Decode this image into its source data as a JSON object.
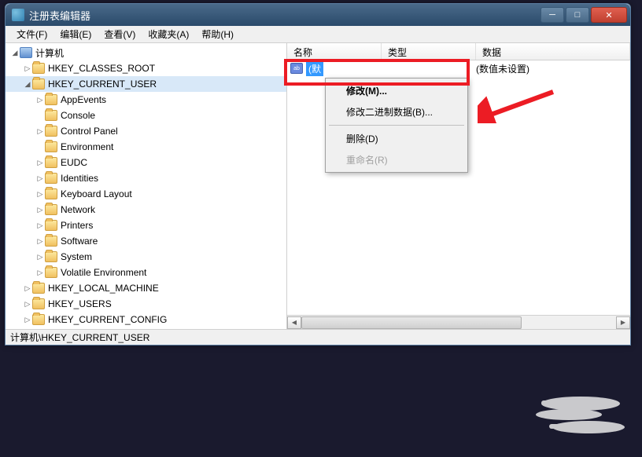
{
  "title": "注册表编辑器",
  "menus": {
    "file": "文件(F)",
    "edit": "编辑(E)",
    "view": "查看(V)",
    "favorites": "收藏夹(A)",
    "help": "帮助(H)"
  },
  "tree": {
    "root": "计算机",
    "hkcr": "HKEY_CLASSES_ROOT",
    "hkcu": "HKEY_CURRENT_USER",
    "items": [
      "AppEvents",
      "Console",
      "Control Panel",
      "Environment",
      "EUDC",
      "Identities",
      "Keyboard Layout",
      "Network",
      "Printers",
      "Software",
      "System",
      "Volatile Environment"
    ],
    "hklm": "HKEY_LOCAL_MACHINE",
    "hku": "HKEY_USERS",
    "hkcc": "HKEY_CURRENT_CONFIG"
  },
  "columns": {
    "name": "名称",
    "type": "类型",
    "data": "数据"
  },
  "value_row": {
    "icon_text": "ab",
    "name": "(默",
    "data": "(数值未设置)"
  },
  "context_menu": {
    "modify": "修改(M)...",
    "modify_binary": "修改二进制数据(B)...",
    "delete": "删除(D)",
    "rename": "重命名(R)"
  },
  "status_path": "计算机\\HKEY_CURRENT_USER"
}
